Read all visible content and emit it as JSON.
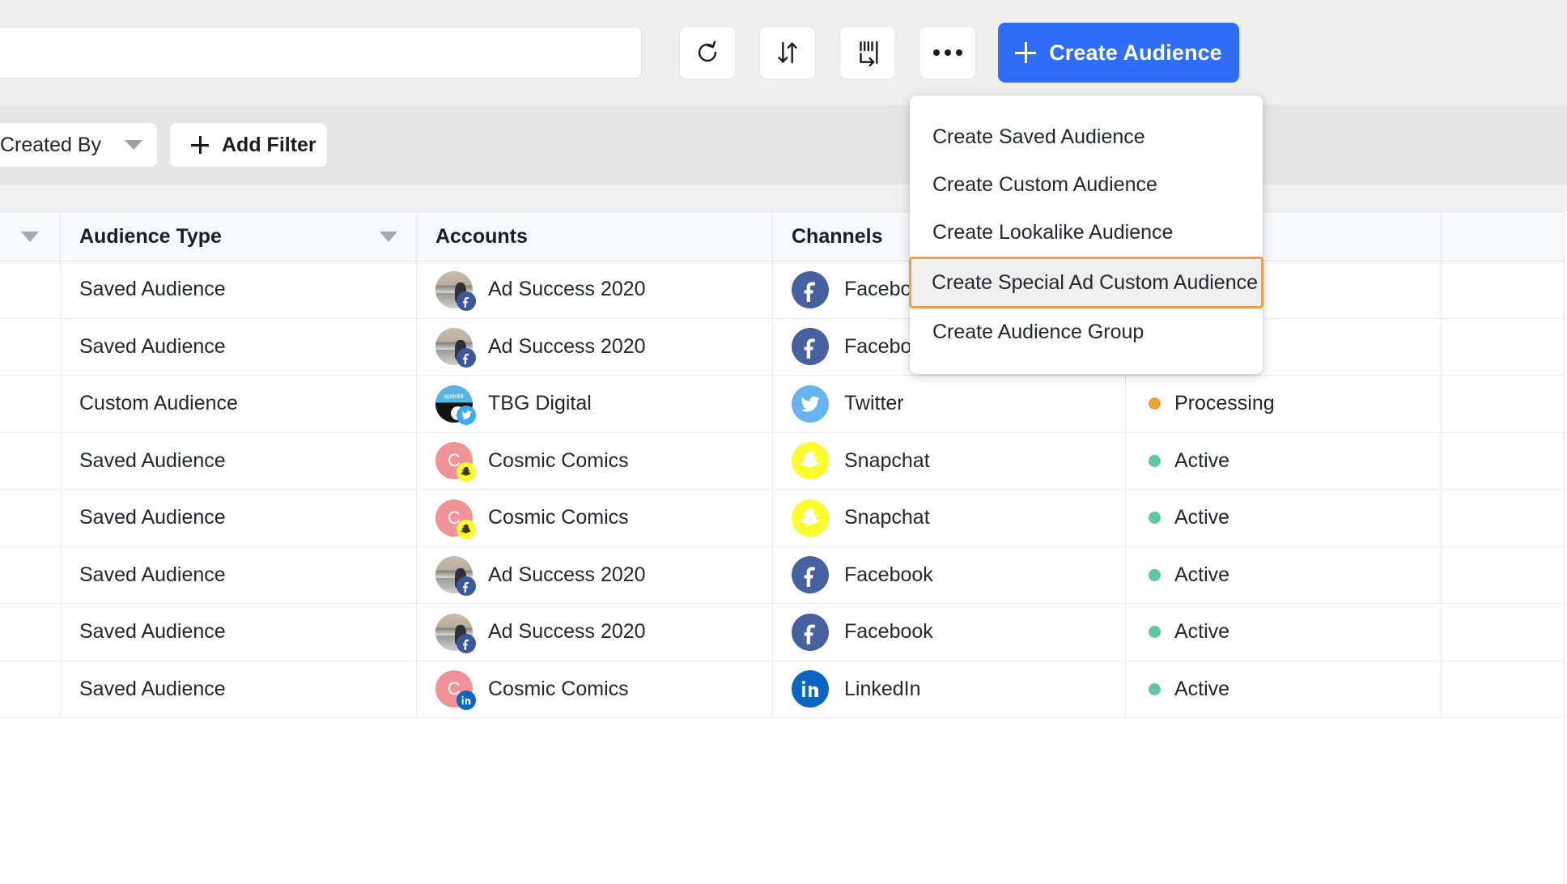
{
  "toolbar": {
    "search_value": "",
    "search_placeholder": "",
    "buttons": [
      {
        "name": "refresh",
        "icon": "refresh-icon",
        "label": ""
      },
      {
        "name": "sort",
        "icon": "sort-arrows-icon",
        "label": ""
      },
      {
        "name": "columns",
        "icon": "columns-icon",
        "label": ""
      },
      {
        "name": "more",
        "icon": "ellipsis-icon",
        "label": ""
      }
    ],
    "create_label": "Create Audience"
  },
  "filterbar": {
    "created_by_label": "Created By",
    "add_filter_label": "Add Filter"
  },
  "menu": {
    "items": [
      {
        "label": "Create Saved Audience",
        "highlighted": false
      },
      {
        "label": "Create Custom Audience",
        "highlighted": false
      },
      {
        "label": "Create Lookalike Audience",
        "highlighted": false
      },
      {
        "label": "Create Special Ad Custom Audience",
        "highlighted": true
      },
      {
        "label": "Create Audience Group",
        "highlighted": false
      }
    ],
    "highlight_color": "#eda04b"
  },
  "table": {
    "columns": [
      {
        "key": "check",
        "label": ""
      },
      {
        "key": "type",
        "label": "Audience Type"
      },
      {
        "key": "account",
        "label": "Accounts"
      },
      {
        "key": "channel",
        "label": "Channels"
      },
      {
        "key": "status",
        "label": ""
      },
      {
        "key": "last",
        "label": ""
      }
    ],
    "rows": [
      {
        "type": "Saved Audience",
        "account": "Ad Success 2020",
        "avatar": "photo",
        "badge": "facebook",
        "channel": "Facebook",
        "channel_icon": "facebook",
        "status": "",
        "status_color": ""
      },
      {
        "type": "Saved Audience",
        "account": "Ad Success 2020",
        "avatar": "photo",
        "badge": "facebook",
        "channel": "Facebook",
        "channel_icon": "facebook",
        "status": "",
        "status_color": ""
      },
      {
        "type": "Custom Audience",
        "account": "TBG Digital",
        "avatar": "sprinklr",
        "badge": "twitter",
        "channel": "Twitter",
        "channel_icon": "twitter",
        "status": "Processing",
        "status_color": "#e8a33d"
      },
      {
        "type": "Saved Audience",
        "account": "Cosmic Comics",
        "avatar": "letter-C",
        "badge": "snapchat",
        "channel": "Snapchat",
        "channel_icon": "snapchat",
        "status": "Active",
        "status_color": "#5fc79a"
      },
      {
        "type": "Saved Audience",
        "account": "Cosmic Comics",
        "avatar": "letter-C",
        "badge": "snapchat",
        "channel": "Snapchat",
        "channel_icon": "snapchat",
        "status": "Active",
        "status_color": "#5fc79a"
      },
      {
        "type": "Saved Audience",
        "account": "Ad Success 2020",
        "avatar": "photo",
        "badge": "facebook",
        "channel": "Facebook",
        "channel_icon": "facebook",
        "status": "Active",
        "status_color": "#5fc79a"
      },
      {
        "type": "Saved Audience",
        "account": "Ad Success 2020",
        "avatar": "photo",
        "badge": "facebook",
        "channel": "Facebook",
        "channel_icon": "facebook",
        "status": "Active",
        "status_color": "#5fc79a"
      },
      {
        "type": "Saved Audience",
        "account": "Cosmic Comics",
        "avatar": "letter-C",
        "badge": "linkedin",
        "channel": "LinkedIn",
        "channel_icon": "linkedin",
        "status": "Active",
        "status_color": "#5fc79a"
      }
    ],
    "avatar_letter": "C",
    "sprinklr_word": "sprinklr"
  },
  "colors": {
    "accent": "#2f6ef4",
    "highlight": "#eda04b",
    "active": "#5fc79a",
    "processing": "#e8a33d",
    "facebook": "#4761a0",
    "twitter": "#66b3ef",
    "snapchat": "#fdfa2e",
    "linkedin": "#0a66c2"
  }
}
